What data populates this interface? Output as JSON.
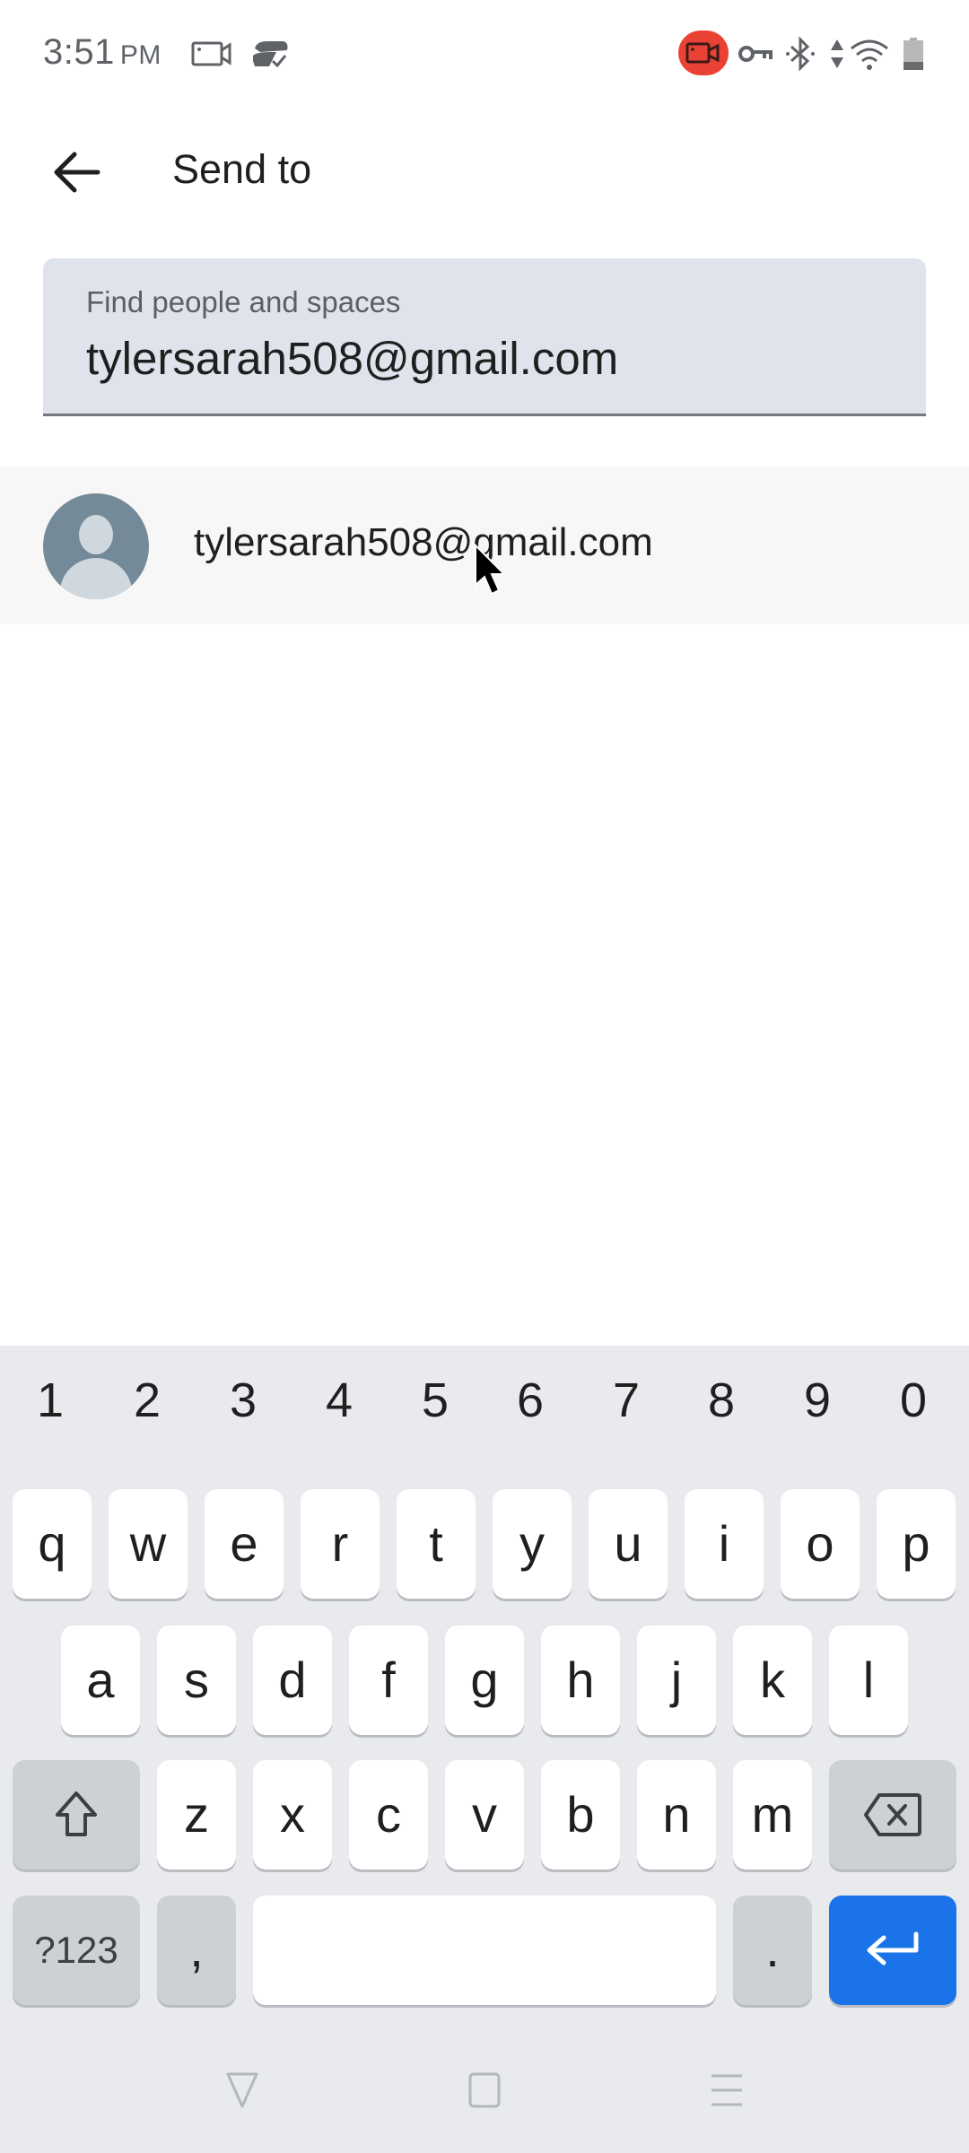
{
  "status_bar": {
    "time": "3:51",
    "ampm": "PM",
    "left_icons": [
      "screen-record-icon",
      "sync-check-icon"
    ],
    "right_icons": [
      "recording-indicator-icon",
      "vpn-key-icon",
      "bluetooth-icon",
      "data-arrows-icon",
      "wifi-icon",
      "battery-icon"
    ],
    "recording_color": "#e94235"
  },
  "app_bar": {
    "back_icon": "arrow-back-icon",
    "title": "Send to"
  },
  "search": {
    "label": "Find people and spaces",
    "value": "tylersarah508@gmail.com"
  },
  "suggestions": [
    {
      "avatar": "default-person-avatar",
      "text": "tylersarah508@gmail.com"
    }
  ],
  "keyboard": {
    "number_row": [
      "1",
      "2",
      "3",
      "4",
      "5",
      "6",
      "7",
      "8",
      "9",
      "0"
    ],
    "row1": [
      "q",
      "w",
      "e",
      "r",
      "t",
      "y",
      "u",
      "i",
      "o",
      "p"
    ],
    "row2": [
      "a",
      "s",
      "d",
      "f",
      "g",
      "h",
      "j",
      "k",
      "l"
    ],
    "row3": [
      "z",
      "x",
      "c",
      "v",
      "b",
      "n",
      "m"
    ],
    "shift_icon": "shift-icon",
    "backspace_icon": "backspace-icon",
    "symbols_label": "?123",
    "comma_label": ",",
    "period_label": ".",
    "enter_icon": "enter-icon",
    "enter_color": "#1a73e8"
  },
  "nav_bar": [
    "back-triangle-icon",
    "home-square-icon",
    "recents-menu-icon"
  ]
}
